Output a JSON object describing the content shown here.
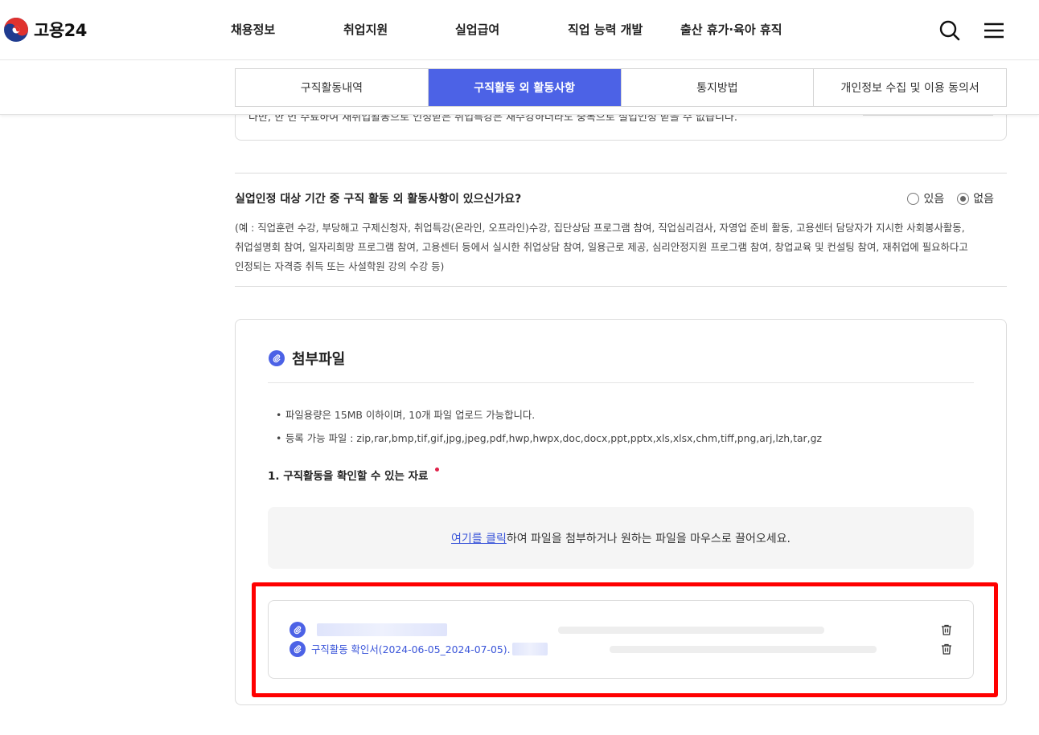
{
  "header": {
    "logo_text": "고용24",
    "menu": [
      "채용정보",
      "취업지원",
      "실업급여",
      "직업 능력 개발",
      "출산 휴가·육아 휴직"
    ],
    "search_icon": "search-icon",
    "menu_icon": "hamburger-menu-icon"
  },
  "tabs": [
    {
      "label": "구직활동내역",
      "active": false
    },
    {
      "label": "구직활동 외 활동사항",
      "active": true
    },
    {
      "label": "통지방법",
      "active": false
    },
    {
      "label": "개인정보 수집 및 이용 동의서",
      "active": false
    }
  ],
  "clipped_notice": "다만, 한 번 수료하여 재취업활동으로 인정받은 취업특강은 재수강하더라도 중복으로 실업인정 받을 수 없습니다.",
  "question": {
    "title": "실업인정 대상 기간 중 구직 활동 외 활동사항이 있으신가요?",
    "options": [
      {
        "label": "있음",
        "checked": false
      },
      {
        "label": "없음",
        "checked": true
      }
    ],
    "description": [
      "(예 : 직업훈련 수강, 부당해고 구제신청자, 취업특강(온라인, 오프라인)수강, 집단상담 프로그램 참여, 직업심리검사, 자영업 준비 활동, 고용센터 담당자가 지시한 사회봉사활동,",
      "취업설명회 참여, 일자리희망 프로그램 참여, 고용센터 등에서 실시한 취업상담 참여, 일용근로 제공, 심리안정지원 프로그램 참여, 창업교육 및 컨설팅 참여, 재취업에 필요하다고",
      "인정되는 자격증 취득 또는 사설학원 강의 수강 등)"
    ]
  },
  "attachment": {
    "title": "첨부파일",
    "notes": [
      "파일용량은 15MB 이하이며, 10개 파일 업로드 가능합니다.",
      "등록 가능 파일 : zip,rar,bmp,tif,gif,jpg,jpeg,pdf,hwp,hwpx,doc,docx,ppt,pptx,xls,xlsx,chm,tiff,png,arj,lzh,tar,gz"
    ],
    "required_label": "1. 구직활동을 확인할 수 있는 자료",
    "drop_link": "여기를 클릭",
    "drop_text": "하여 파일을 첨부하거나 원하는 파일을 마우스로 끌어오세요.",
    "files": [
      {
        "name": ""
      },
      {
        "name": "구직활동 확인서(2024-06-05_2024-07-05)."
      }
    ]
  },
  "colors": {
    "accent": "#4c62e6",
    "link": "#3a55d9",
    "required": "#e0224a",
    "highlight": "#ff0000"
  }
}
